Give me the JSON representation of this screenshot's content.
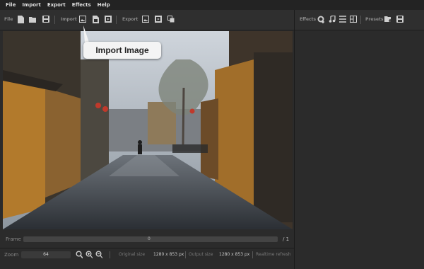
{
  "menu": [
    "File",
    "Import",
    "Export",
    "Effects",
    "Help"
  ],
  "toolbar": {
    "file_label": "File",
    "import_label": "Import",
    "export_label": "Export",
    "effects_label": "Effects",
    "presets_label": "Presets"
  },
  "tooltip": {
    "text": "Import Image"
  },
  "frame": {
    "label": "Frame",
    "value": "0",
    "total": "/ 1"
  },
  "bottom": {
    "zoom_label": "Zoom",
    "zoom_value": "64",
    "original_size_label": "Original size",
    "original_size_value": "1280 x 853 px",
    "output_size_label": "Output size",
    "output_size_value": "1280 x 853 px",
    "realtime_label": "Realtime refresh"
  },
  "colors": {
    "background": "#2b2b2b",
    "menubar": "#232323",
    "tooltip": "#f4f4f4"
  }
}
